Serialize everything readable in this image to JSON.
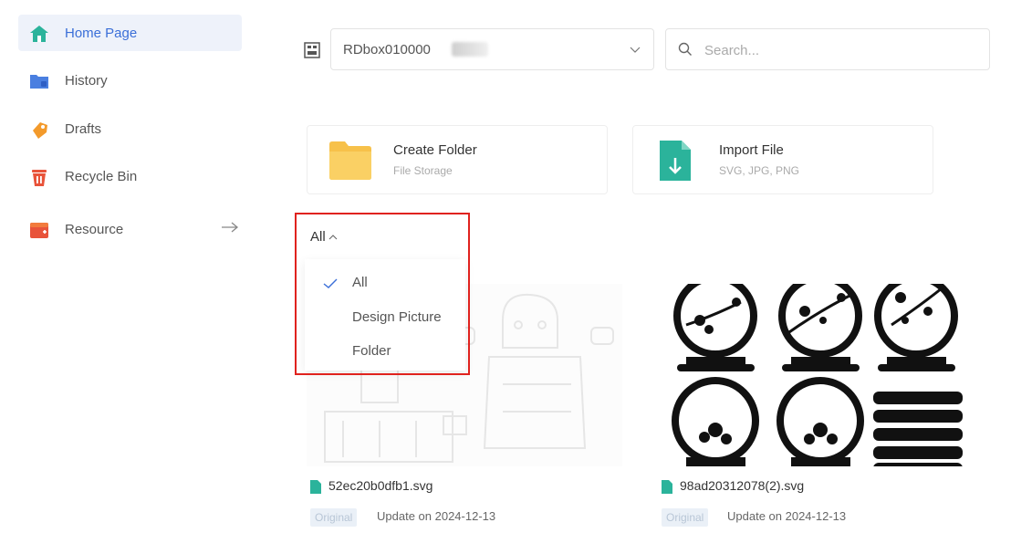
{
  "sidebar": {
    "items": [
      {
        "label": "Home Page",
        "icon": "home-icon",
        "active": true
      },
      {
        "label": "History",
        "icon": "history-icon"
      },
      {
        "label": "Drafts",
        "icon": "drafts-icon"
      },
      {
        "label": "Recycle Bin",
        "icon": "recycle-bin-icon"
      },
      {
        "label": "Resource",
        "icon": "resource-icon"
      }
    ],
    "resource_arrow_icon": "arrow-right-icon"
  },
  "topbar": {
    "device_icon": "device-icon",
    "device_value": "RDbox010000",
    "search_placeholder": "Search..."
  },
  "actions": {
    "create_folder": {
      "title": "Create Folder",
      "subtitle": "File Storage",
      "icon": "folder-icon"
    },
    "import_file": {
      "title": "Import File",
      "subtitle": "SVG, JPG, PNG",
      "icon": "import-file-icon"
    }
  },
  "filter": {
    "current": "All",
    "options": [
      "All",
      "Design Picture",
      "Folder"
    ],
    "selected_index": 0
  },
  "files": [
    {
      "name": "52ec20b0dfb1.svg",
      "tag": "Original",
      "updated": "Update on 2024-12-13"
    },
    {
      "name": "98ad20312078(2).svg",
      "tag": "Original",
      "updated": "Update on 2024-12-13"
    }
  ],
  "colors": {
    "accent": "#3b6fd8",
    "highlight_border": "#e0221e",
    "file_icon": "#2bb39b",
    "folder": "#f7c14a"
  }
}
